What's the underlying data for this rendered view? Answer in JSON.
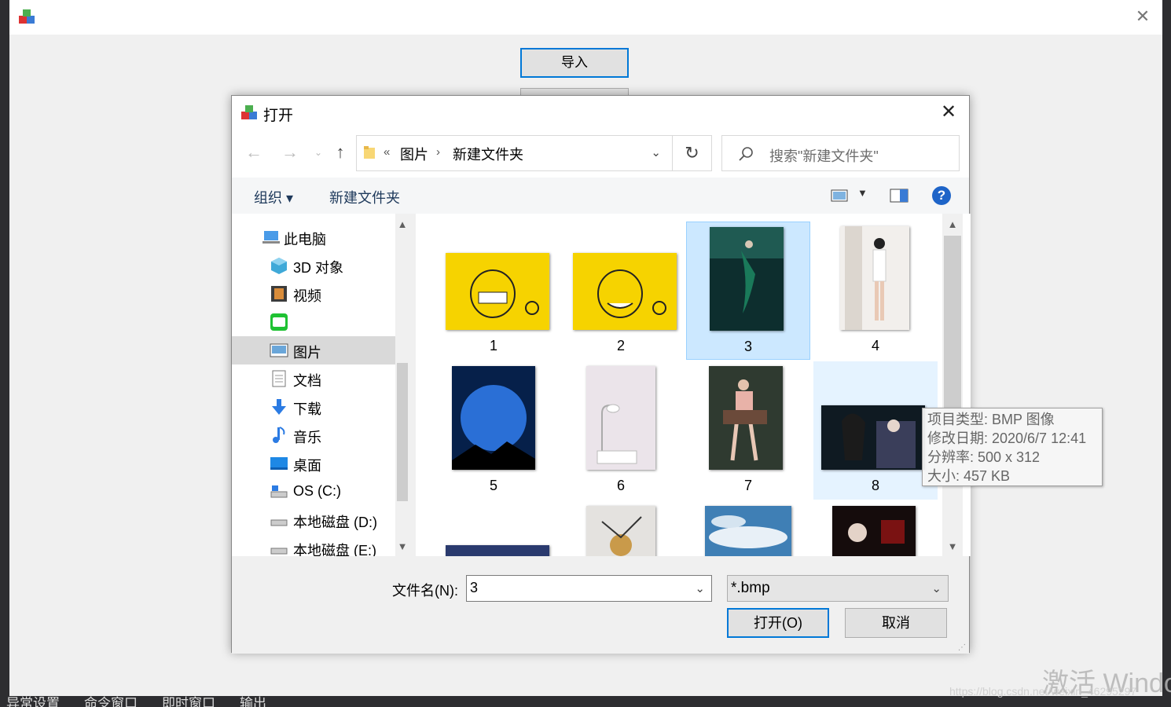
{
  "ide": {
    "bottom_tabs": [
      "异常设置",
      "命令窗口",
      "即时窗口",
      "输出"
    ]
  },
  "app": {
    "import_label": "导入"
  },
  "dialog": {
    "title": "打开",
    "nav": {
      "breadcrumb_prefix": "«",
      "crumbs": [
        "图片",
        "新建文件夹"
      ],
      "search_placeholder": "搜索\"新建文件夹\""
    },
    "toolbar": {
      "organize": "组织 ▾",
      "new_folder": "新建文件夹",
      "help": "?"
    },
    "sidebar": [
      {
        "label": "此电脑",
        "icon": "computer-icon"
      },
      {
        "label": "3D 对象",
        "icon": "cube-3d-icon"
      },
      {
        "label": "视频",
        "icon": "video-icon"
      },
      {
        "label": "",
        "icon": "iqiyi-icon"
      },
      {
        "label": "图片",
        "icon": "pictures-icon",
        "selected": true
      },
      {
        "label": "文档",
        "icon": "documents-icon"
      },
      {
        "label": "下载",
        "icon": "download-icon"
      },
      {
        "label": "音乐",
        "icon": "music-icon"
      },
      {
        "label": "桌面",
        "icon": "desktop-icon"
      },
      {
        "label": "OS (C:)",
        "icon": "drive-c-icon"
      },
      {
        "label": "本地磁盘 (D:)",
        "icon": "drive-icon"
      },
      {
        "label": "本地磁盘 (E:)",
        "icon": "drive-icon"
      }
    ],
    "files": [
      "1",
      "2",
      "3",
      "4",
      "5",
      "6",
      "7",
      "8"
    ],
    "tooltip": {
      "type": "项目类型: BMP 图像",
      "modified": "修改日期: 2020/6/7 12:41",
      "resolution": "分辨率: 500 x 312",
      "size": "大小: 457 KB"
    },
    "footer": {
      "filename_label": "文件名(N):",
      "filename_value": "3",
      "filter_value": "*.bmp",
      "open_label": "打开(O)",
      "cancel_label": "取消"
    }
  },
  "watermark": {
    "text": "激活 Windo",
    "url": "https://blog.csdn.net/weixin_46295297"
  }
}
